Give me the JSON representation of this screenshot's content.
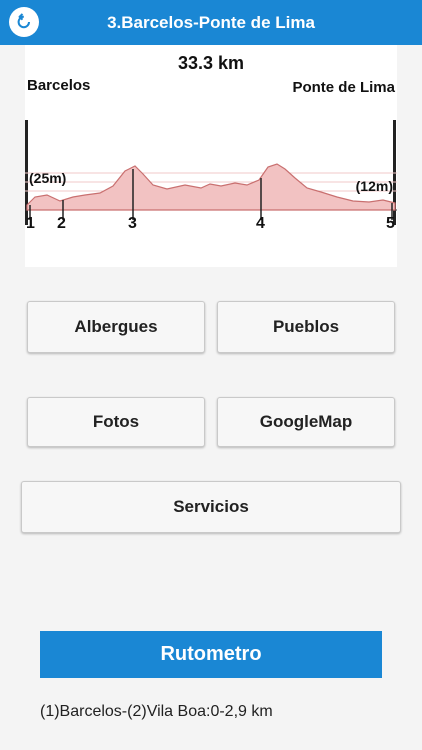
{
  "header": {
    "title": "3.Barcelos-Ponte de Lima",
    "back_icon": "back-arrow-icon",
    "bg_color": "#1a87d4"
  },
  "profile": {
    "distance": "33.3 km",
    "start_label": "Barcelos",
    "end_label": "Ponte de Lima",
    "start_elevation": "(25m)",
    "end_elevation": "(12m)",
    "markers": [
      "1",
      "2",
      "3",
      "4",
      "5"
    ]
  },
  "buttons": {
    "albergues": "Albergues",
    "pueblos": "Pueblos",
    "fotos": "Fotos",
    "googlemap": "GoogleMap",
    "servicios": "Servicios"
  },
  "rutometro": {
    "label": "Rutometro"
  },
  "route": {
    "stages": [
      "(1)Barcelos-(2)Vila Boa:0-2,9 km"
    ]
  }
}
